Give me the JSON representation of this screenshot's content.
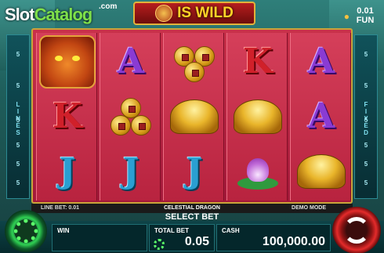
{
  "brand": {
    "logo_slot": "Slot",
    "logo_catalog": "Catalog",
    "logo_com": ".com"
  },
  "banner": {
    "text": "IS WILD",
    "icon": "dragon-mini-icon"
  },
  "fun_badge": {
    "line1": "0.01",
    "line2": "FUN"
  },
  "left_panel": {
    "label": "LINES",
    "numbers": [
      "5",
      "5",
      "5",
      "5",
      "5",
      "5"
    ]
  },
  "right_panel": {
    "label": "FIXED",
    "numbers": [
      "5",
      "5",
      "5",
      "5",
      "5",
      "5"
    ]
  },
  "reels": [
    [
      "dragon",
      "K",
      "J"
    ],
    [
      "A",
      "coins",
      "J"
    ],
    [
      "coins",
      "ingot",
      "J"
    ],
    [
      "K",
      "ingot",
      "lotus"
    ],
    [
      "A",
      "A",
      "ingot"
    ]
  ],
  "info_strip": {
    "line_bet": "LINE BET: 0.01",
    "game_title": "CELESTIAL DRAGON",
    "mode": "DEMO MODE"
  },
  "select_bet": "SELECT BET",
  "bottom": {
    "win_label": "WIN",
    "win_value": "",
    "total_bet_label": "TOTAL BET",
    "total_bet_value": "0.05",
    "cash_label": "CASH",
    "cash_value": "100,000.00"
  },
  "colors": {
    "accent_gold": "#e2b23a",
    "reel_red": "#c9314a",
    "panel_teal": "#0e4448",
    "spin_red": "#e42b2b",
    "settings_green": "#2fcf52"
  }
}
